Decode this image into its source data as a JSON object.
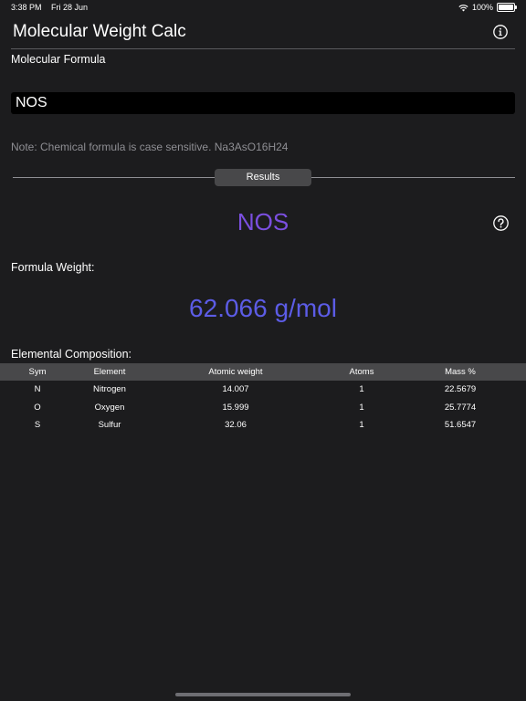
{
  "status_bar": {
    "time": "3:38 PM",
    "date": "Fri 28 Jun",
    "battery": "100%"
  },
  "nav": {
    "title": "Molecular Weight Calc"
  },
  "input": {
    "label": "Molecular Formula",
    "value": "NOS",
    "note": "Note: Chemical formula is case sensitive. Na3AsO16H24"
  },
  "results": {
    "section_label": "Results",
    "formula": "NOS",
    "weight_label": "Formula Weight:",
    "weight_value": "62.066 g/mol",
    "composition_label": "Elemental Composition:"
  },
  "table": {
    "headers": {
      "sym": "Sym",
      "element": "Element",
      "atomic_weight": "Atomic weight",
      "atoms": "Atoms",
      "mass": "Mass %"
    },
    "rows": [
      {
        "sym": "N",
        "element": "Nitrogen",
        "atomic_weight": "14.007",
        "atoms": "1",
        "mass": "22.5679"
      },
      {
        "sym": "O",
        "element": "Oxygen",
        "atomic_weight": "15.999",
        "atoms": "1",
        "mass": "25.7774"
      },
      {
        "sym": "S",
        "element": "Sulfur",
        "atomic_weight": "32.06",
        "atoms": "1",
        "mass": "51.6547"
      }
    ]
  },
  "colors": {
    "background": "#1c1c1e",
    "formula_accent": "#7b4fe0",
    "weight_accent": "#5c5ce6",
    "header_bg": "#48484a"
  },
  "icons": {
    "info": "info-circle-icon",
    "help": "question-circle-icon",
    "wifi": "wifi-icon",
    "battery": "battery-icon"
  }
}
